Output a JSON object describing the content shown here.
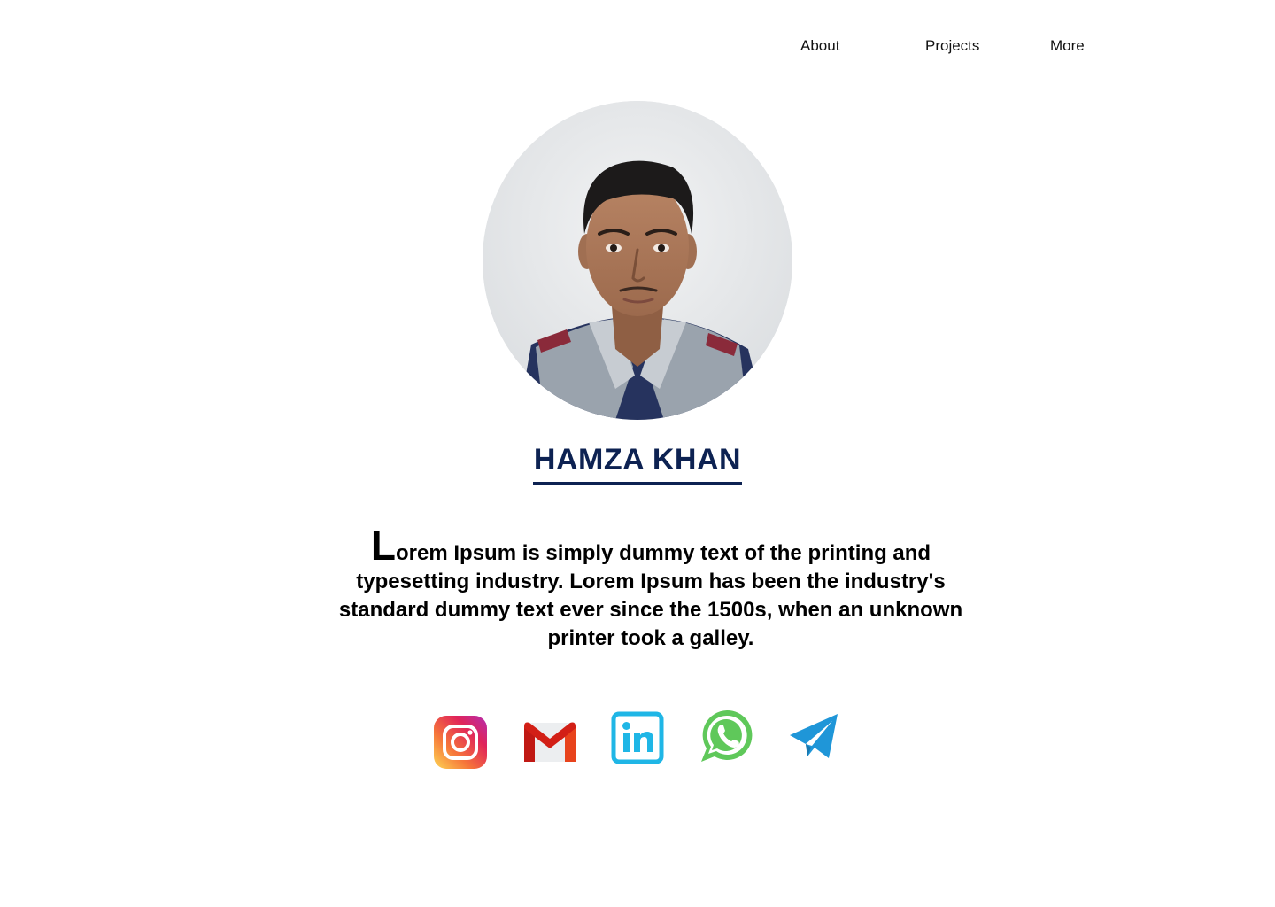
{
  "nav": {
    "items": [
      {
        "label": "About"
      },
      {
        "label": "Projects"
      },
      {
        "label": "More"
      }
    ]
  },
  "profile": {
    "photo_icon": "profile-photo",
    "name": "HAMZA KHAN",
    "name_color": "#0d2252",
    "bio_initial": "L",
    "bio_rest": "orem Ipsum is simply dummy text of the printing and typesetting industry. Lorem Ipsum has been the industry's standard dummy text ever since the 1500s, when an unknown printer took a galley."
  },
  "socials": [
    {
      "icon": "instagram-icon"
    },
    {
      "icon": "gmail-icon"
    },
    {
      "icon": "linkedin-icon"
    },
    {
      "icon": "whatsapp-icon"
    },
    {
      "icon": "telegram-icon"
    }
  ],
  "colors": {
    "background": "#ffffff",
    "accent": "#0d2252",
    "whatsapp": "#5fc85a",
    "telegram": "#1f96d8",
    "linkedin": "#1fb6e6"
  }
}
